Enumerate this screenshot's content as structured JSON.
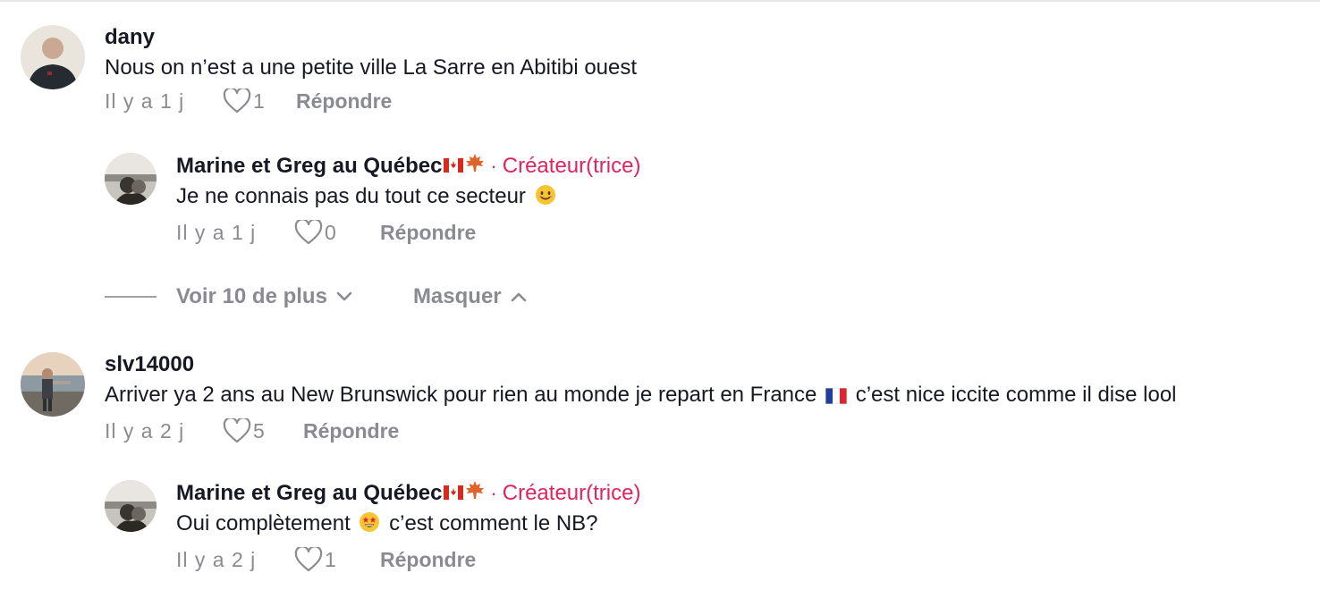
{
  "comments": [
    {
      "username": "dany",
      "text": "Nous on n’est a une petite ville La Sarre en Abitibi ouest",
      "time": "Il y a 1 j",
      "likes": "1",
      "reply_label": "Répondre"
    },
    {
      "username": "Marine et Greg au Québec",
      "separator": "·",
      "creator_badge": "Créateur(trice)",
      "text": "Je ne connais pas du tout ce secteur",
      "text_emoji": "smiling-face",
      "time": "Il y a 1 j",
      "likes": "0",
      "reply_label": "Répondre"
    },
    {
      "username": "slv14000",
      "text_before_flag": "Arriver ya 2 ans au New Brunswick pour rien au monde je repart en France",
      "text_after_flag": "c’est nice iccite comme il dise lool",
      "time": "Il y a 2 j",
      "likes": "5",
      "reply_label": "Répondre"
    },
    {
      "username": "Marine et Greg au Québec",
      "separator": "·",
      "creator_badge": "Créateur(trice)",
      "text_before_emoji": "Oui complètement",
      "text_after_emoji": "c’est comment le NB?",
      "time": "Il y a 2 j",
      "likes": "1",
      "reply_label": "Répondre"
    }
  ],
  "replies_controls": {
    "more_label": "Voir 10 de plus",
    "hide_label": "Masquer"
  },
  "colors": {
    "creator": "#e0245e",
    "muted": "#8a8b91",
    "text": "#161823"
  }
}
